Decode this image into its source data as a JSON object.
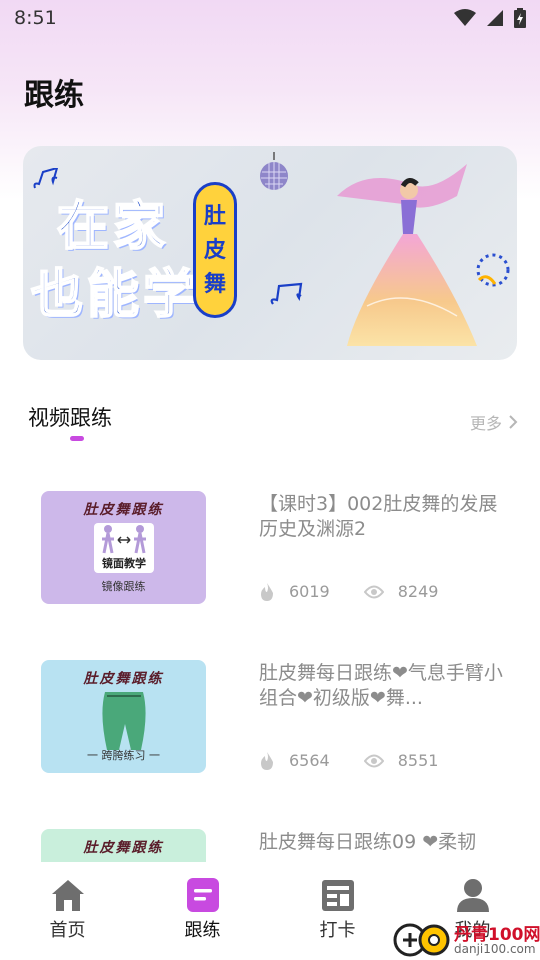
{
  "status_bar": {
    "time": "8:51"
  },
  "header": {
    "title": "跟练"
  },
  "banner": {
    "line1": "在家",
    "line2": "也能学",
    "pill_chars": [
      "肚",
      "皮",
      "舞"
    ]
  },
  "section": {
    "title": "视频跟练",
    "more_label": "更多"
  },
  "videos": [
    {
      "title": "【课时3】002肚皮舞的发展历史及渊源2",
      "thumb_title": "肚皮舞跟练",
      "thumb_center": "镜面教学",
      "thumb_caption": "镜像跟练",
      "thumb_bg": "#cdb8ea",
      "hot": "6019",
      "views": "8249"
    },
    {
      "title": "肚皮舞每日跟练❤气息手臂小组合❤初级版❤舞...",
      "thumb_title": "肚皮舞跟练",
      "thumb_caption": "一 跨胯练习 一",
      "thumb_bg": "#b8e2f2",
      "hot": "6564",
      "views": "8551"
    },
    {
      "title": "肚皮舞每日跟练09 ❤柔韧",
      "thumb_title": "肚皮舞跟练",
      "thumb_bg": "#c9efdc"
    }
  ],
  "tabbar": {
    "items": [
      {
        "label": "首页"
      },
      {
        "label": "跟练"
      },
      {
        "label": "打卡"
      },
      {
        "label": "我的"
      }
    ]
  },
  "watermark": {
    "text": "丹青100网",
    "sub": "danji100.com"
  },
  "colors": {
    "accent": "#c84ae0",
    "tab_active": "#c84ae0",
    "tab_inactive": "#6e6e6e"
  }
}
